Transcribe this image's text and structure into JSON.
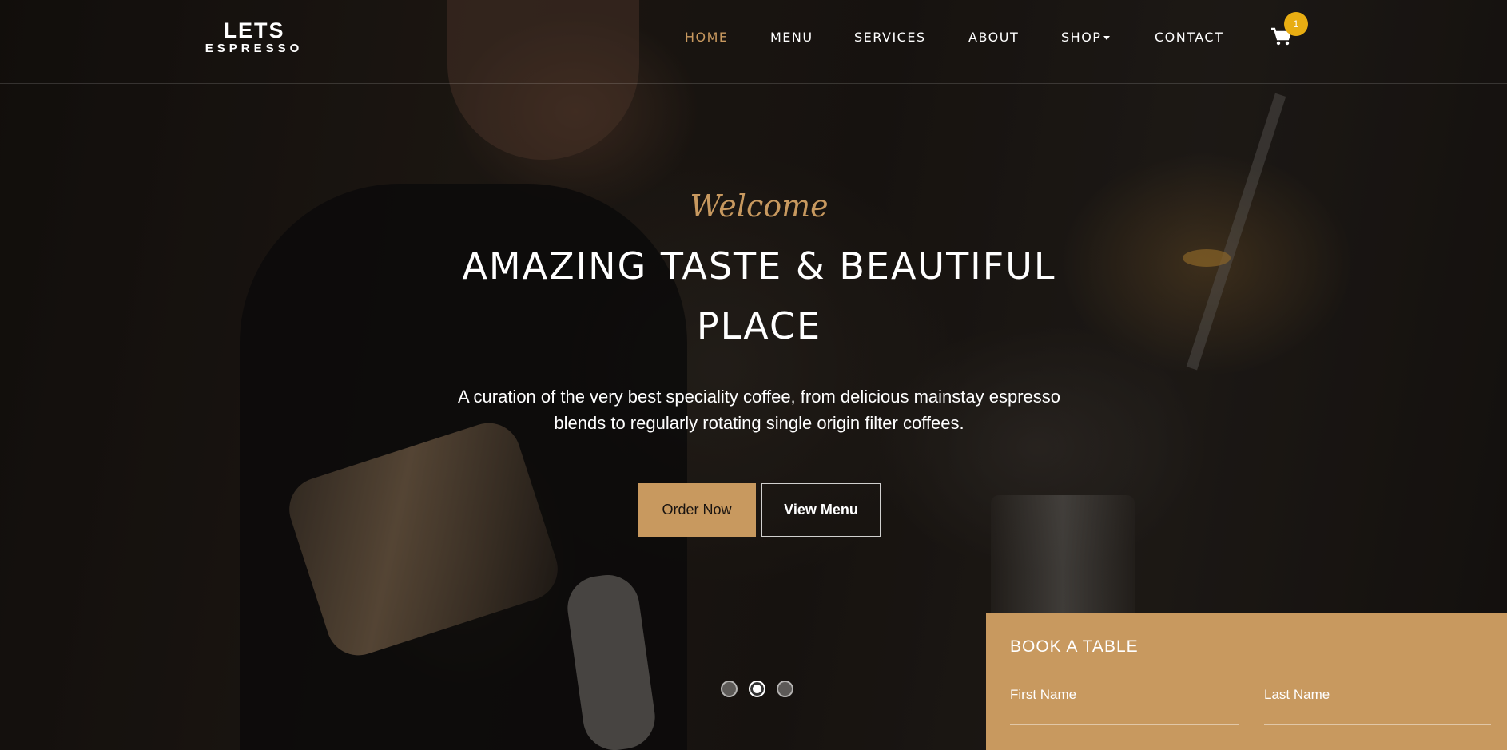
{
  "brand": {
    "logo_top": "LETS",
    "logo_bottom": "ESPRESSO"
  },
  "nav": {
    "items": [
      {
        "label": "HOME",
        "active": true
      },
      {
        "label": "MENU"
      },
      {
        "label": "SERVICES"
      },
      {
        "label": "ABOUT"
      },
      {
        "label": "SHOP"
      },
      {
        "label": "CONTACT"
      }
    ],
    "cart_count": "1"
  },
  "hero": {
    "eyebrow": "Welcome",
    "headline_line1": "AMAZING TASTE & BEAUTIFUL",
    "headline_line2": "PLACE",
    "subtitle_line1": "A curation of the very best speciality coffee, from delicious mainstay espresso",
    "subtitle_line2": "blends to regularly rotating single origin filter coffees.",
    "buttons": {
      "order": "Order Now",
      "menu": "View Menu"
    },
    "slides": 3,
    "active_slide": 2
  },
  "booking": {
    "title": "BOOK A TABLE",
    "first_name_label": "First Name",
    "last_name_label": "Last Name"
  },
  "colors": {
    "accent": "#c8995f",
    "badge": "#e8ad12"
  }
}
